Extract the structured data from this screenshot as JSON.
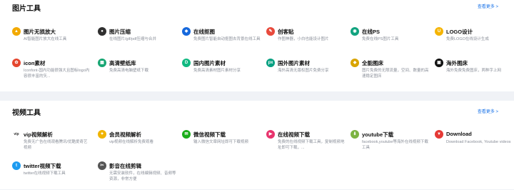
{
  "sections": [
    {
      "title": "图片工具",
      "more": "查看更多 >",
      "items": [
        {
          "name": "图片无损放大",
          "desc": "AI智能图片放大在线工具",
          "icon": "magnify-icon",
          "color": "#f2a900",
          "glyph": "▲"
        },
        {
          "name": "图片压缩",
          "desc": "在线图片/gif/pdf压缩与合并",
          "icon": "compress-icon",
          "color": "#2f2f2f",
          "glyph": "●"
        },
        {
          "name": "在线抠图",
          "desc": "免费图片智能自动抠图去背景在线工具",
          "icon": "cutout-icon",
          "color": "#1668dc",
          "glyph": "◆"
        },
        {
          "name": "创客贴",
          "desc": "作图神器，小白也能设计图片",
          "icon": "chuangketie-icon",
          "color": "#e84a3c",
          "glyph": "✎"
        },
        {
          "name": "在线PS",
          "desc": "免费在线PS图片工具",
          "icon": "ps-icon",
          "color": "#11a37f",
          "glyph": "◉"
        },
        {
          "name": "LOGO设计",
          "desc": "免费LOGO在线设计生成",
          "icon": "logo-design-icon",
          "color": "#f5b400",
          "glyph": "U"
        },
        {
          "name": "icon素材",
          "desc": "Iconfont-国内功能很强大且图标logo内容很丰富的矢...",
          "icon": "iconfont-icon",
          "color": "#e5462e",
          "glyph": "✿"
        },
        {
          "name": "高清壁纸库",
          "desc": "免费高清电脑壁纸下载",
          "icon": "wallpaper-icon",
          "color": "#17a673",
          "glyph": "▦"
        },
        {
          "name": "国内图片素材",
          "desc": "免费高清素材图片素材分享",
          "icon": "cn-images-icon",
          "color": "#10b981",
          "glyph": "D"
        },
        {
          "name": "国外图片素材",
          "desc": "海外高清无版权图片免费分享",
          "icon": "pexels-icon",
          "color": "#07a081",
          "glyph": "px"
        },
        {
          "name": "全能图床",
          "desc": "图片免费的无限流量，空间、数量的高速稳定图床",
          "icon": "image-host-icon",
          "color": "#d9a400",
          "glyph": "◆"
        },
        {
          "name": "海外图床",
          "desc": "海外免费免费图床，两种字上网",
          "icon": "overseas-host-icon",
          "color": "#111111",
          "glyph": "▣"
        }
      ]
    },
    {
      "title": "视频工具",
      "more": "查看更多 >",
      "items": [
        {
          "name": "vip视频解析",
          "desc": "免费无广告在线观看腾讯/优酷爱奇艺视频",
          "icon": "vip-icon",
          "color": "#ffffff",
          "glyph": "vip"
        },
        {
          "name": "会员视频解析",
          "desc": "vip视频在线解析免费观看",
          "icon": "member-video-icon",
          "color": "#f0b400",
          "glyph": "✦"
        },
        {
          "name": "微信视频下载",
          "desc": "输入微信文章网址即可下载视频",
          "icon": "wechat-icon",
          "color": "#1aad19",
          "glyph": "✉"
        },
        {
          "name": "在线视频下载",
          "desc": "免费的在线视频下载工具，复制视频地址即可下载，...",
          "icon": "play-icon",
          "color": "#e8336d",
          "glyph": "▶"
        },
        {
          "name": "youtube下载",
          "desc": "facebook,youtube等海外在线视频下载工具",
          "icon": "download-icon",
          "color": "#7cb342",
          "glyph": "⬇"
        },
        {
          "name": "Download",
          "desc": "Download Facebook, Youtube videos",
          "icon": "download-circle-icon",
          "color": "#e53935",
          "glyph": "▼"
        },
        {
          "name": "twitter视频下载",
          "desc": "twitter在线视频下载工具",
          "icon": "twitter-icon",
          "color": "#1d9bf0",
          "glyph": "t"
        },
        {
          "name": "影音在线剪辑",
          "desc": "无需安装软件，在线编辑视频、音频等资源，非常方便",
          "icon": "video-edit-icon",
          "color": "#555555",
          "glyph": "✂"
        }
      ]
    }
  ]
}
